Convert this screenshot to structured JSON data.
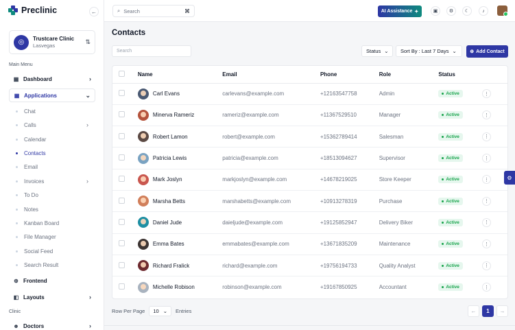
{
  "brand": {
    "name": "Preclinic"
  },
  "clinic": {
    "name": "Trustcare Clinic",
    "location": "Lasvegas"
  },
  "sidebar": {
    "main_menu_title": "Main Menu",
    "dashboard": "Dashboard",
    "applications": "Applications",
    "sub_items": [
      "Chat",
      "Calls",
      "Calendar",
      "Contacts",
      "Email",
      "Invoices",
      "To Do",
      "Notes",
      "Kanban Board",
      "File Manager",
      "Social Feed",
      "Search Result"
    ],
    "frontend": "Frontend",
    "layouts": "Layouts",
    "clinic_title": "Clinic",
    "doctors": "Doctors"
  },
  "topbar": {
    "search_placeholder": "Search",
    "ai_label": "AI Assistance"
  },
  "page": {
    "title": "Contacts",
    "search_placeholder": "Search",
    "status_filter": "Status",
    "sort_label": "Sort By : Last 7 Days",
    "add_label": "Add Contact"
  },
  "table": {
    "headers": {
      "name": "Name",
      "email": "Email",
      "phone": "Phone",
      "role": "Role",
      "status": "Status"
    },
    "rows": [
      {
        "name": "Carl Evans",
        "email": "carlevans@example.com",
        "phone": "+12163547758",
        "role": "Admin",
        "status": "Active"
      },
      {
        "name": "Minerva Rameriz",
        "email": "rameriz@example.com",
        "phone": "+11367529510",
        "role": "Manager",
        "status": "Active"
      },
      {
        "name": "Robert Lamon",
        "email": "robert@example.com",
        "phone": "+15362789414",
        "role": "Salesman",
        "status": "Active"
      },
      {
        "name": "Patricia Lewis",
        "email": "patricia@example.com",
        "phone": "+18513094627",
        "role": "Supervisor",
        "status": "Active"
      },
      {
        "name": "Mark Joslyn",
        "email": "markjoslyn@example.com",
        "phone": "+14678219025",
        "role": "Store Keeper",
        "status": "Active"
      },
      {
        "name": "Marsha Betts",
        "email": "marshabetts@example.com",
        "phone": "+10913278319",
        "role": "Purchase",
        "status": "Active"
      },
      {
        "name": "Daniel Jude",
        "email": "daieljude@example.com",
        "phone": "+19125852947",
        "role": "Delivery Biker",
        "status": "Active"
      },
      {
        "name": "Emma Bates",
        "email": "emmabates@example.com",
        "phone": "+13671835209",
        "role": "Maintenance",
        "status": "Active"
      },
      {
        "name": "Richard Fralick",
        "email": "richard@example.com",
        "phone": "+19756194733",
        "role": "Quality Analyst",
        "status": "Active"
      },
      {
        "name": "Michelle Robison",
        "email": "robinson@example.com",
        "phone": "+19167850925",
        "role": "Accountant",
        "status": "Active"
      }
    ]
  },
  "footer": {
    "row_per_page": "Row Per Page",
    "per_page_value": "10",
    "entries": "Entries",
    "current_page": "1"
  },
  "colors": {
    "primary": "#2e37a4",
    "accent": "#0e8a7e",
    "active_green": "#16a34a"
  },
  "avatar_colors": [
    "#4b5a73",
    "#b5533c",
    "#5c4a44",
    "#7aa3c2",
    "#c9574f",
    "#d17f5b",
    "#1e8fa3",
    "#3d3533",
    "#6e2a2f",
    "#a9b3bf"
  ]
}
